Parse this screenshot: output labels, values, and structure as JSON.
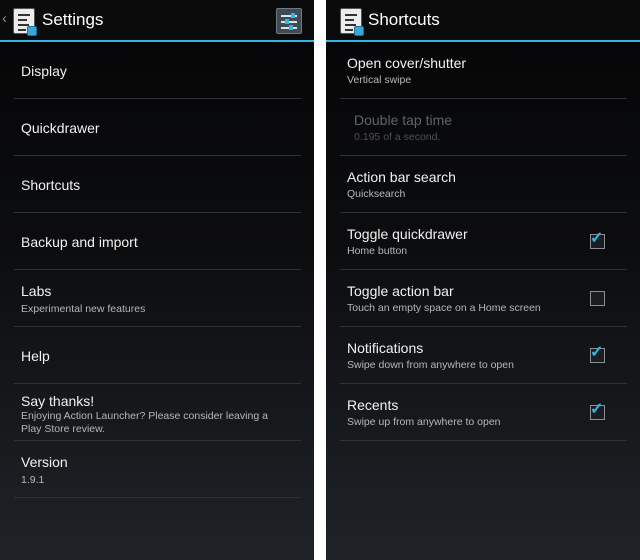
{
  "left": {
    "title": "Settings",
    "back_glyph": "‹",
    "items": [
      {
        "title": "Display"
      },
      {
        "title": "Quickdrawer"
      },
      {
        "title": "Shortcuts"
      },
      {
        "title": "Backup and import"
      },
      {
        "title": "Labs",
        "subtitle": "Experimental new features"
      },
      {
        "title": "Help"
      },
      {
        "title": "Say thanks!",
        "subtitle": "Enjoying Action Launcher? Please consider leaving a Play Store review."
      },
      {
        "title": "Version",
        "subtitle": "1.9.1"
      }
    ]
  },
  "right": {
    "title": "Shortcuts",
    "items": [
      {
        "title": "Open cover/shutter",
        "subtitle": "Vertical swipe"
      },
      {
        "title": "Double tap time",
        "subtitle": "0.195 of a second.",
        "enabled": false
      },
      {
        "title": "Action bar search",
        "subtitle": "Quicksearch"
      },
      {
        "title": "Toggle quickdrawer",
        "subtitle": "Home button",
        "checked": true
      },
      {
        "title": "Toggle action bar",
        "subtitle": "Touch an empty space on a Home screen",
        "checked": false
      },
      {
        "title": "Notifications",
        "subtitle": "Swipe down from anywhere to open",
        "checked": true
      },
      {
        "title": "Recents",
        "subtitle": "Swipe up from anywhere to open",
        "checked": true
      }
    ]
  },
  "icons": {
    "back": "chevron-left-icon",
    "app": "action-launcher-icon",
    "settings_action": "sliders-icon",
    "check": "checkmark-icon"
  },
  "colors": {
    "accent": "#33b5e5",
    "background": "#0c0d0f"
  }
}
